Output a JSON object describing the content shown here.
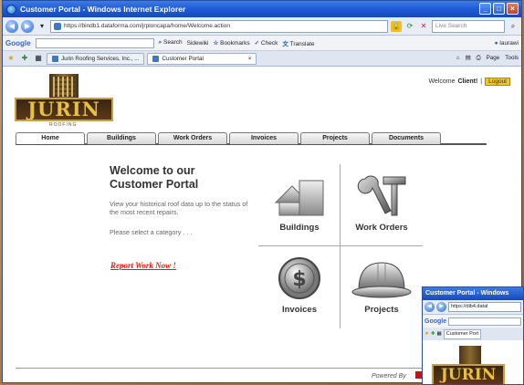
{
  "window": {
    "title": "Customer Portal - Windows Internet Explorer",
    "url": "https://bindb1.dataforma.com/jrploncapa/home/Welcome.action",
    "search_placeholder": "Live Search"
  },
  "google_toolbar": {
    "logo": "Google",
    "items": [
      "Search",
      "Sidewiki",
      "Bookmarks",
      "Check",
      "Translate"
    ],
    "user": "laurawi"
  },
  "browser_tabs": [
    {
      "label": "Jurin Roofing Services, Inc., ..."
    },
    {
      "label": "Customer Portal"
    }
  ],
  "browser_tools": {
    "page": "Page",
    "tools": "Tools"
  },
  "header": {
    "logo_text": "JURIN",
    "logo_sub": "ROOFING",
    "welcome_prefix": "Welcome",
    "welcome_name": "Client!",
    "separator": "|",
    "logout": "Logout"
  },
  "nav_tabs": [
    "Home",
    "Buildings",
    "Work Orders",
    "Invoices",
    "Projects",
    "Documents"
  ],
  "intro": {
    "title_line1": "Welcome to our",
    "title_line2": "Customer Portal",
    "description": "View your historical roof data up to the status of the most recent repairs.",
    "prompt": "Please select a category . . .",
    "report_link": "Report Work Now !"
  },
  "categories": [
    {
      "label": "Buildings"
    },
    {
      "label": "Work Orders"
    },
    {
      "label": "Invoices"
    },
    {
      "label": "Projects"
    }
  ],
  "footer": {
    "powered_by": "Powered By"
  },
  "second_window": {
    "title": "Customer Portal - Windows",
    "url": "https://dib4.datal",
    "google": "Google",
    "tab": "Customer Port",
    "logo_text": "JURIN"
  },
  "colors": {
    "titlebar": "#1d5bd6",
    "logout_bg": "#f0c820",
    "report_link": "#e01818",
    "logo_gold": "#e8c040"
  }
}
